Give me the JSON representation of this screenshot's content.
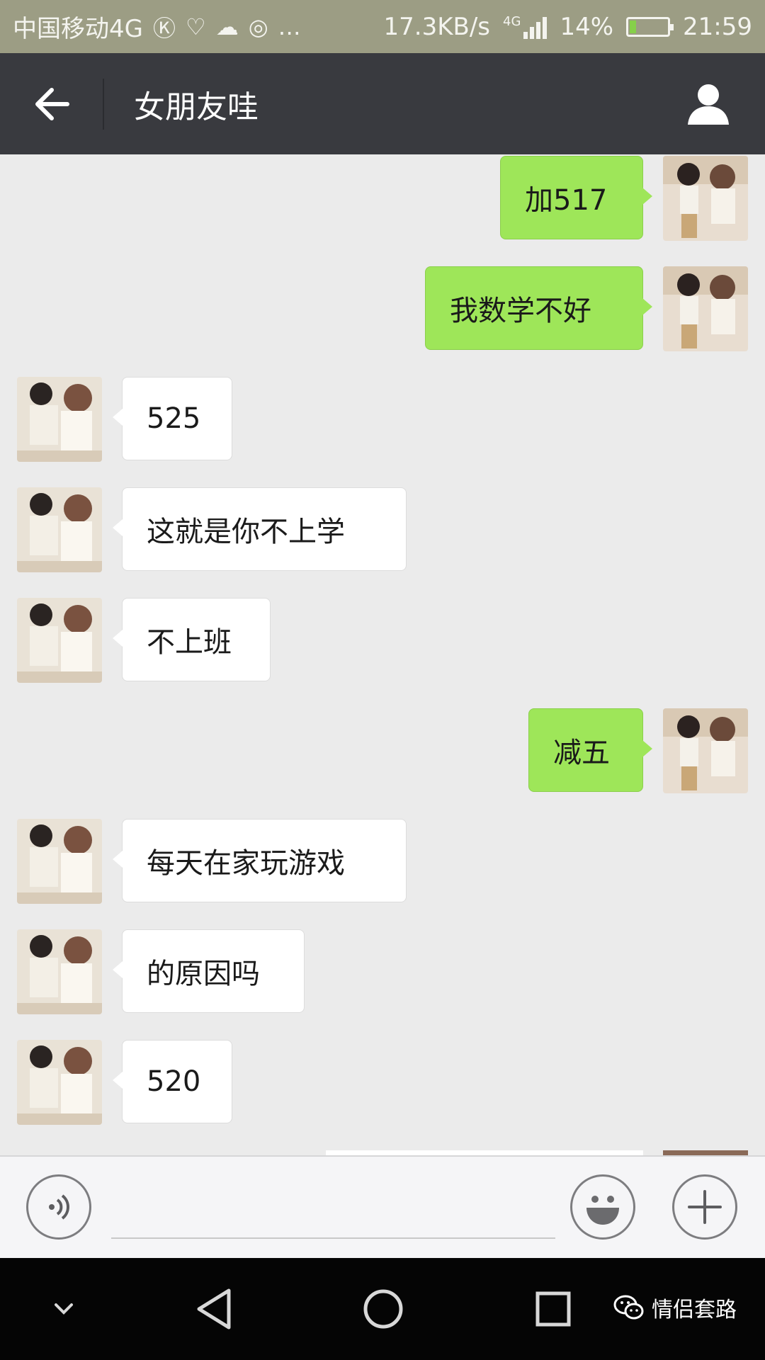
{
  "status_bar": {
    "carrier": "中国移动4G",
    "speed": "17.3KB/s",
    "network": "4G",
    "battery": "14%",
    "time": "21:59",
    "battery_fraction": 0.14
  },
  "header": {
    "title": "女朋友哇"
  },
  "messages": [
    {
      "side": "sent",
      "text": "加517"
    },
    {
      "side": "sent",
      "text": "我数学不好"
    },
    {
      "side": "recv",
      "text": "525"
    },
    {
      "side": "recv",
      "text": "这就是你不上学"
    },
    {
      "side": "recv",
      "text": "不上班"
    },
    {
      "side": "sent",
      "text": "减五"
    },
    {
      "side": "recv",
      "text": "每天在家玩游戏"
    },
    {
      "side": "recv",
      "text": "的原因吗"
    },
    {
      "side": "recv",
      "text": "520"
    }
  ],
  "input": {
    "value": ""
  },
  "watermark": {
    "text": "情侣套路"
  },
  "colors": {
    "sent_bubble": "#9ee659",
    "recv_bubble": "#ffffff",
    "header_bg": "#393a3f",
    "status_bg": "#9c9d84"
  }
}
